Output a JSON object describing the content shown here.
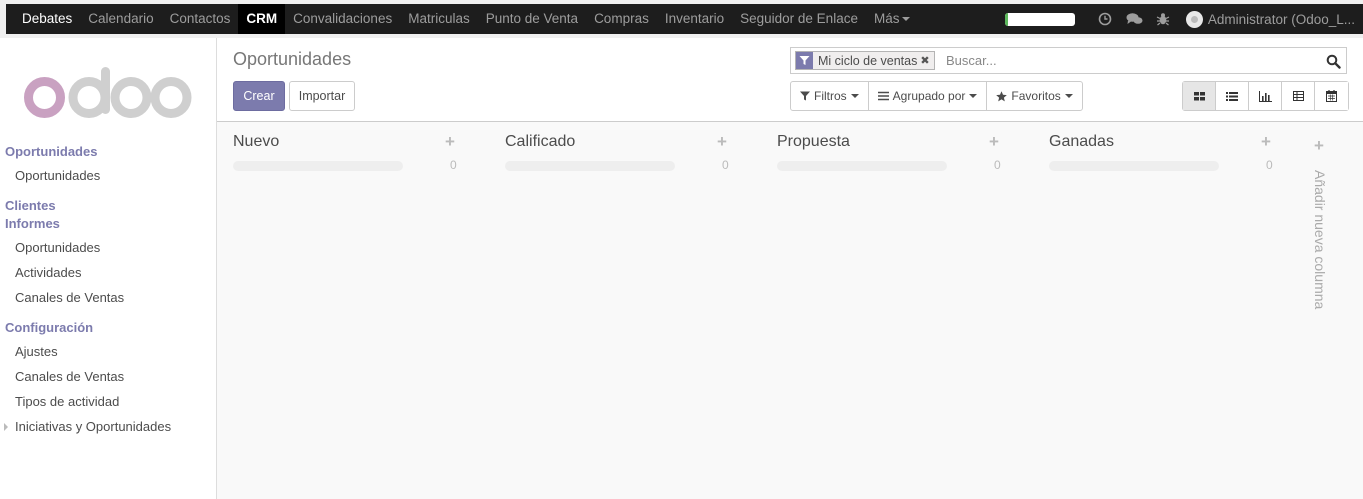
{
  "topnav": {
    "brand": "Debates",
    "items": [
      "Calendario",
      "Contactos"
    ],
    "active": "CRM",
    "items_after": [
      "Convalidaciones",
      "Matriculas",
      "Punto de Venta",
      "Compras",
      "Inventario",
      "Seguidor de Enlace"
    ],
    "more": "Más",
    "progress": 0.05,
    "icons": [
      "clock-icon",
      "chat-icon",
      "bug-icon"
    ],
    "user": "Administrator (Odoo_L..."
  },
  "logo": {
    "text": "odoo",
    "color": "#c9a1c1"
  },
  "sidebar": {
    "sections": [
      {
        "label": "Oportunidades",
        "items": [
          "Oportunidades"
        ]
      },
      {
        "label": "Clientes",
        "items": []
      },
      {
        "label": "Informes",
        "items": [
          "Oportunidades",
          "Actividades",
          "Canales de Ventas"
        ]
      },
      {
        "label": "Configuración",
        "items": [
          "Ajustes",
          "Canales de Ventas",
          "Tipos de actividad",
          "Iniciativas y Oportunidades"
        ]
      }
    ]
  },
  "control": {
    "title": "Oportunidades",
    "create_label": "Crear",
    "import_label": "Importar",
    "search": {
      "facet": "Mi ciclo de ventas",
      "placeholder": "Buscar..."
    },
    "filters_label": "Filtros",
    "groupby_label": "Agrupado por",
    "favorites_label": "Favoritos",
    "views": [
      "kanban-view",
      "list-view",
      "graph-view",
      "pivot-view",
      "calendar-view"
    ],
    "active_view": "kanban-view"
  },
  "kanban": {
    "columns": [
      {
        "title": "Nuevo",
        "count": "0"
      },
      {
        "title": "Calificado",
        "count": "0"
      },
      {
        "title": "Propuesta",
        "count": "0"
      },
      {
        "title": "Ganadas",
        "count": "0"
      }
    ],
    "add_column_label": "Añadir nueva columna"
  },
  "colors": {
    "accent": "#7c7bad",
    "nav_bg": "#1d1d1d",
    "progress": "#5cb85c"
  }
}
